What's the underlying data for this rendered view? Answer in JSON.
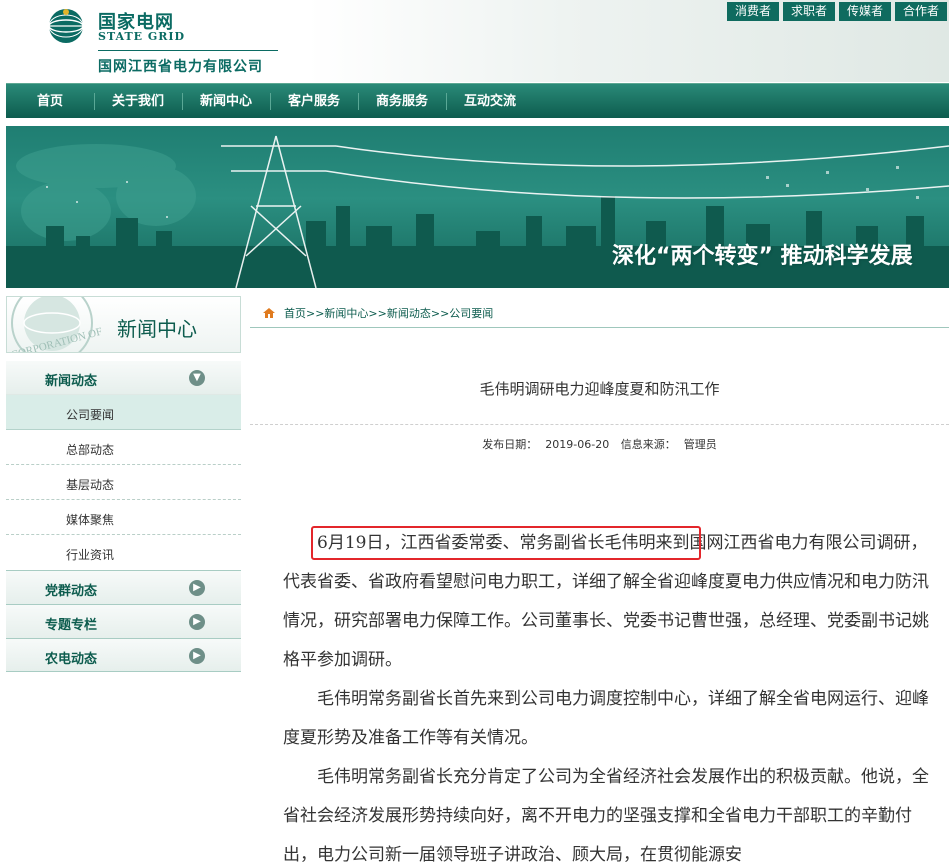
{
  "header": {
    "logo_cn": "国家电网",
    "logo_en": "STATE GRID",
    "company": "国网江西省电力有限公司",
    "top_links": [
      "消费者",
      "求职者",
      "传媒者",
      "合作者"
    ]
  },
  "nav": [
    "首页",
    "关于我们",
    "新闻中心",
    "客户服务",
    "商务服务",
    "互动交流"
  ],
  "banner": {
    "slogan": "深化“两个转变” 推动科学发展"
  },
  "sidebar": {
    "title": "新闻中心",
    "logo_text": "CORPORATION OF",
    "section": "新闻动态",
    "sub_items": [
      "公司要闻",
      "总部动态",
      "基层动态",
      "媒体聚焦",
      "行业资讯"
    ],
    "active_index": 0,
    "other_sections": [
      "党群动态",
      "专题专栏",
      "农电动态"
    ]
  },
  "breadcrumb": "首页>>新闻中心>>新闻动态>>公司要闻",
  "article": {
    "title": "毛伟明调研电力迎峰度夏和防汛工作",
    "date_label": "发布日期：",
    "date": "2019-06-20",
    "source_label": "信息来源：",
    "source": "管理员",
    "paragraphs": [
      "6月19日，江西省委常委、常务副省长毛伟明来到国网江西省电力有限公司调研，代表省委、省政府看望慰问电力职工，详细了解全省迎峰度夏电力供应情况和电力防汛情况，研究部署电力保障工作。公司董事长、党委书记曹世强，总经理、党委副书记姚格平参加调研。",
      "毛伟明常务副省长首先来到公司电力调度控制中心，详细了解全省电网运行、迎峰度夏形势及准备工作等有关情况。",
      "毛伟明常务副省长充分肯定了公司为全省经济社会发展作出的积极贡献。他说，全省社会经济发展形势持续向好，离不开电力的坚强支撑和全省电力干部职工的辛勤付出，电力公司新一届领导班子讲政治、顾大局，在贯彻能源安"
    ]
  },
  "colors": {
    "brand": "#0d5c4e",
    "highlight": "#e3262b"
  }
}
